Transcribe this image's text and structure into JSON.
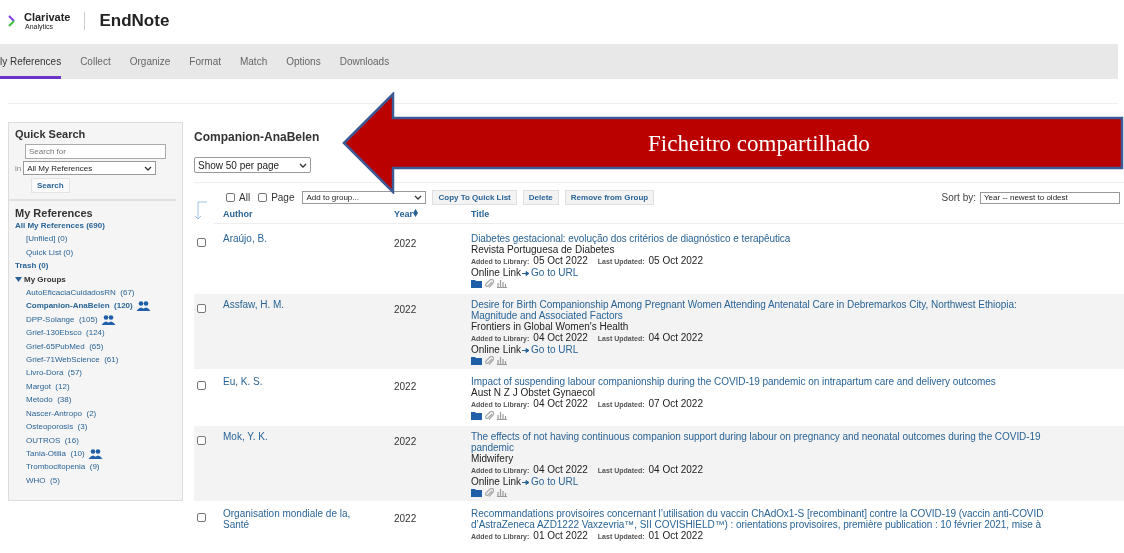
{
  "header": {
    "brand": "Clarivate",
    "brand_sub": "Analytics",
    "product": "EndNote"
  },
  "nav_tabs": [
    {
      "label": "ly References",
      "selected": true
    },
    {
      "label": "Collect",
      "selected": false
    },
    {
      "label": "Organize",
      "selected": false
    },
    {
      "label": "Format",
      "selected": false
    },
    {
      "label": "Match",
      "selected": false
    },
    {
      "label": "Options",
      "selected": false
    },
    {
      "label": "Downloads",
      "selected": false
    }
  ],
  "quick_search": {
    "title": "Quick Search",
    "placeholder": "Search for",
    "in_label": "in",
    "scope": "All My References",
    "button": "Search"
  },
  "my_references": {
    "title": "My References",
    "all": "All My References (690)",
    "unfiled": "[Unfiled] (0)",
    "quick_list": "Quick List (0)",
    "trash": "Trash (0)",
    "groups_title": "My Groups",
    "groups_expanded": true,
    "groups": [
      {
        "name": "AutoEficaciaCuidadosRN",
        "count": "(67)",
        "selected": false,
        "shared": false
      },
      {
        "name": "Companion-AnaBelen",
        "count": "(120)",
        "selected": true,
        "shared": true
      },
      {
        "name": "DPP-Solange",
        "count": "(105)",
        "selected": false,
        "shared": true
      },
      {
        "name": "Grief-130Ebsco",
        "count": "(124)",
        "selected": false,
        "shared": false
      },
      {
        "name": "Grief-65PubMed",
        "count": "(65)",
        "selected": false,
        "shared": false
      },
      {
        "name": "Grief-71WebScience",
        "count": "(61)",
        "selected": false,
        "shared": false
      },
      {
        "name": "Livro-Dora",
        "count": "(57)",
        "selected": false,
        "shared": false
      },
      {
        "name": "Margot",
        "count": "(12)",
        "selected": false,
        "shared": false
      },
      {
        "name": "Metodo",
        "count": "(38)",
        "selected": false,
        "shared": false
      },
      {
        "name": "Nascer-Antropo",
        "count": "(2)",
        "selected": false,
        "shared": false
      },
      {
        "name": "Osteoporosis",
        "count": "(3)",
        "selected": false,
        "shared": false
      },
      {
        "name": "OUTROS",
        "count": "(16)",
        "selected": false,
        "shared": false
      },
      {
        "name": "Tania-Otilia",
        "count": "(10)",
        "selected": false,
        "shared": true
      },
      {
        "name": "Trombocitopenia",
        "count": "(9)",
        "selected": false,
        "shared": false
      },
      {
        "name": "WHO",
        "count": "(5)",
        "selected": false,
        "shared": false
      }
    ]
  },
  "main": {
    "title": "Companion-AnaBelen",
    "per_page": "Show 50 per page",
    "toolbar": {
      "all_label": "All",
      "all_checked": false,
      "page_label": "Page",
      "page_checked": false,
      "add_to_group": "Add to group...",
      "buttons": [
        "Copy To Quick List",
        "Delete",
        "Remove from Group"
      ],
      "sort_label": "Sort by:",
      "sort_value": "Year -- newest to oldest"
    },
    "columns": [
      "Author",
      "Year",
      "Title"
    ],
    "rows": [
      {
        "checked": false,
        "author": [
          "Araújo, B."
        ],
        "year": "2022",
        "title_lines": [
          "Diabetes gestacional: evolução dos critérios de diagnóstico e terapêutica"
        ],
        "journal": "Revista Portuguesa de Diabetes",
        "added_label": "Added to Library:",
        "added": "05 Oct 2022",
        "updated_label": "Last Updated:",
        "updated": "05 Oct 2022",
        "online_label": "Online Link",
        "online_link": "Go to URL",
        "icons": true
      },
      {
        "checked": false,
        "author": [
          "Assfaw, H. M."
        ],
        "year": "2022",
        "title_lines": [
          "Desire for Birth Companionship Among Pregnant Women Attending Antenatal Care in Debremarkos City, Northwest Ethiopia:",
          "Magnitude and Associated Factors"
        ],
        "journal": "Frontiers in Global Women's Health",
        "added_label": "Added to Library:",
        "added": "04 Oct 2022",
        "updated_label": "Last Updated:",
        "updated": "04 Oct 2022",
        "online_label": "Online Link",
        "online_link": "Go to URL",
        "icons": true
      },
      {
        "checked": false,
        "author": [
          "Eu, K. S."
        ],
        "year": "2022",
        "title_lines": [
          "Impact of suspending labour companionship during the COVID-19 pandemic on intrapartum care and delivery outcomes"
        ],
        "journal": "Aust N Z J Obstet Gynaecol",
        "added_label": "Added to Library:",
        "added": "04 Oct 2022",
        "updated_label": "Last Updated:",
        "updated": "07 Oct 2022",
        "icons": true
      },
      {
        "checked": false,
        "author": [
          "Mok, Y. K."
        ],
        "year": "2022",
        "title_lines": [
          "The effects of not having continuous companion support during labour on pregnancy and neonatal outcomes during the COVID-19",
          "pandemic"
        ],
        "journal": "Midwifery",
        "added_label": "Added to Library:",
        "added": "04 Oct 2022",
        "updated_label": "Last Updated:",
        "updated": "04 Oct 2022",
        "online_label": "Online Link",
        "online_link": "Go to URL",
        "icons": true
      },
      {
        "checked": false,
        "author": [
          "Organisation mondiale de la,",
          "Santé"
        ],
        "year": "2022",
        "title_lines": [
          "Recommandations provisoires concernant l’utilisation du vaccin ChAdOx1-S [recombinant] contre la COVID-19 (vaccin anti-COVID",
          "d’AstraZeneca AZD1222 Vaxzevria™, SII COVISHIELD™) : orientations provisoires, première publication : 10 février 2021, mise à"
        ],
        "added_label": "Added to Library:",
        "added": "01 Oct 2022",
        "updated_label": "Last Updated:",
        "updated": "01 Oct 2022",
        "icons": false
      }
    ]
  },
  "callout": {
    "text": "Ficheitro compartilhado"
  }
}
